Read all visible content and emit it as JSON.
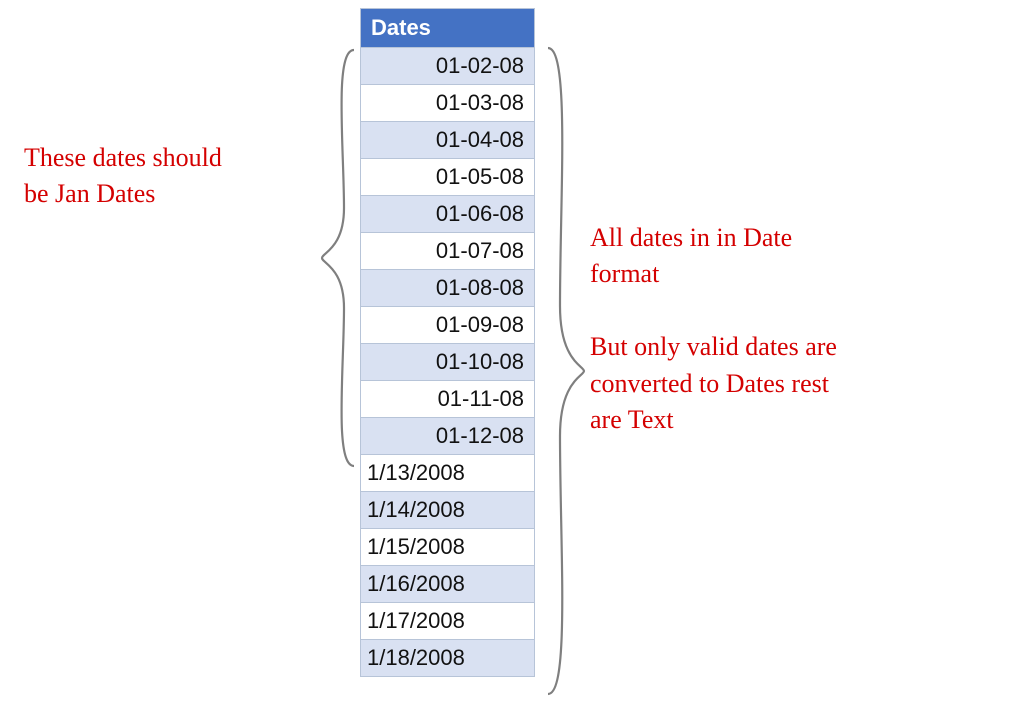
{
  "header": {
    "label": "Dates"
  },
  "rows": [
    {
      "value": "01-02-08",
      "align": "right",
      "band": true
    },
    {
      "value": "01-03-08",
      "align": "right",
      "band": false
    },
    {
      "value": "01-04-08",
      "align": "right",
      "band": true
    },
    {
      "value": "01-05-08",
      "align": "right",
      "band": false
    },
    {
      "value": "01-06-08",
      "align": "right",
      "band": true
    },
    {
      "value": "01-07-08",
      "align": "right",
      "band": false
    },
    {
      "value": "01-08-08",
      "align": "right",
      "band": true
    },
    {
      "value": "01-09-08",
      "align": "right",
      "band": false
    },
    {
      "value": "01-10-08",
      "align": "right",
      "band": true
    },
    {
      "value": "01-11-08",
      "align": "right",
      "band": false
    },
    {
      "value": "01-12-08",
      "align": "right",
      "band": true
    },
    {
      "value": "1/13/2008",
      "align": "left",
      "band": false
    },
    {
      "value": "1/14/2008",
      "align": "left",
      "band": true
    },
    {
      "value": "1/15/2008",
      "align": "left",
      "band": false
    },
    {
      "value": "1/16/2008",
      "align": "left",
      "band": true
    },
    {
      "value": "1/17/2008",
      "align": "left",
      "band": false
    },
    {
      "value": "1/18/2008",
      "align": "left",
      "band": true
    }
  ],
  "annotations": {
    "left": "These dates should\nbe Jan Dates",
    "right": "All dates in in Date\nformat\n\nBut only valid dates are\nconverted to Dates rest\nare Text"
  }
}
